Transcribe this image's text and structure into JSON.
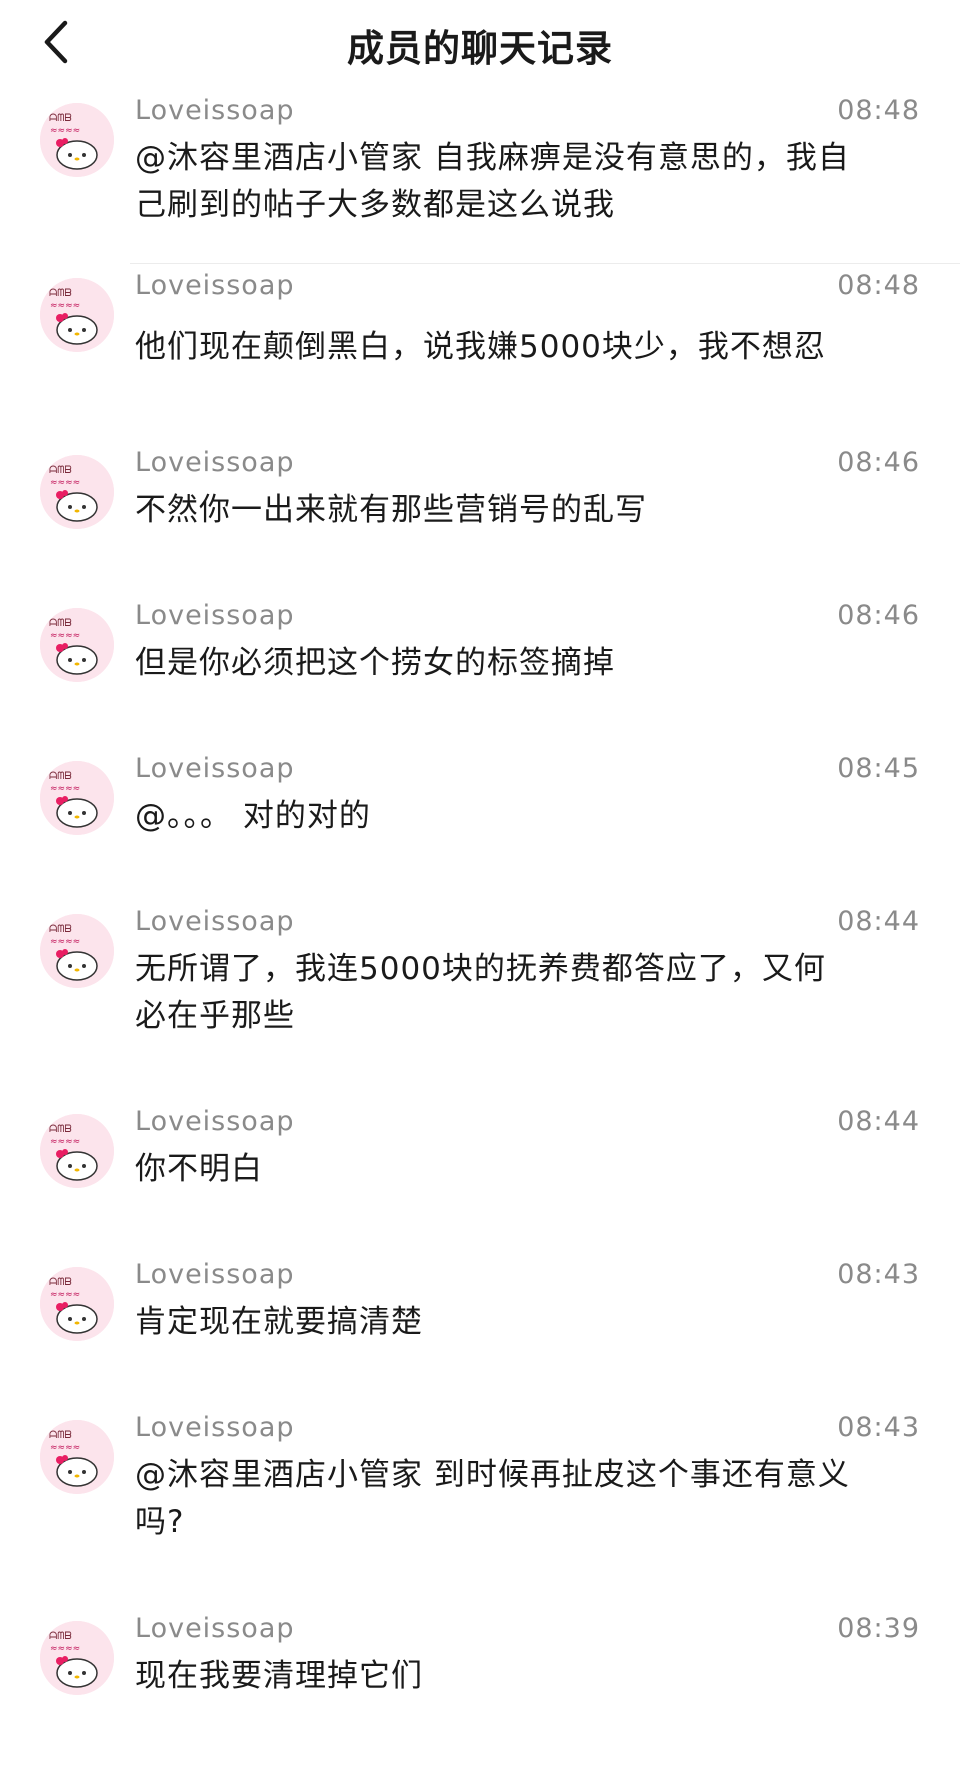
{
  "header": {
    "title": "成员的聊天记录",
    "back_icon": "chevron-left-icon"
  },
  "messages": [
    {
      "name": "Loveissoap",
      "time": "08:48",
      "text": "@沐容里酒店小管家 自我麻痹是没有意思的，我自己刷到的帖子大多数都是这么说我"
    },
    {
      "name": "Loveissoap",
      "time": "08:48",
      "text": "他们现在颠倒黑白，说我嫌5000块少，我不想忍"
    },
    {
      "name": "Loveissoap",
      "time": "08:46",
      "text": "不然你一出来就有那些营销号的乱写"
    },
    {
      "name": "Loveissoap",
      "time": "08:46",
      "text": "但是你必须把这个捞女的标签摘掉"
    },
    {
      "name": "Loveissoap",
      "time": "08:45",
      "text": "@。。。 对的对的"
    },
    {
      "name": "Loveissoap",
      "time": "08:44",
      "text": "无所谓了，我连5000块的抚养费都答应了，又何必在乎那些"
    },
    {
      "name": "Loveissoap",
      "time": "08:44",
      "text": "你不明白"
    },
    {
      "name": "Loveissoap",
      "time": "08:43",
      "text": "肯定现在就要搞清楚"
    },
    {
      "name": "Loveissoap",
      "time": "08:43",
      "text": "@沐容里酒店小管家 到时候再扯皮这个事还有意义吗?"
    },
    {
      "name": "Loveissoap",
      "time": "08:39",
      "text": "现在我要清理掉它们"
    }
  ]
}
